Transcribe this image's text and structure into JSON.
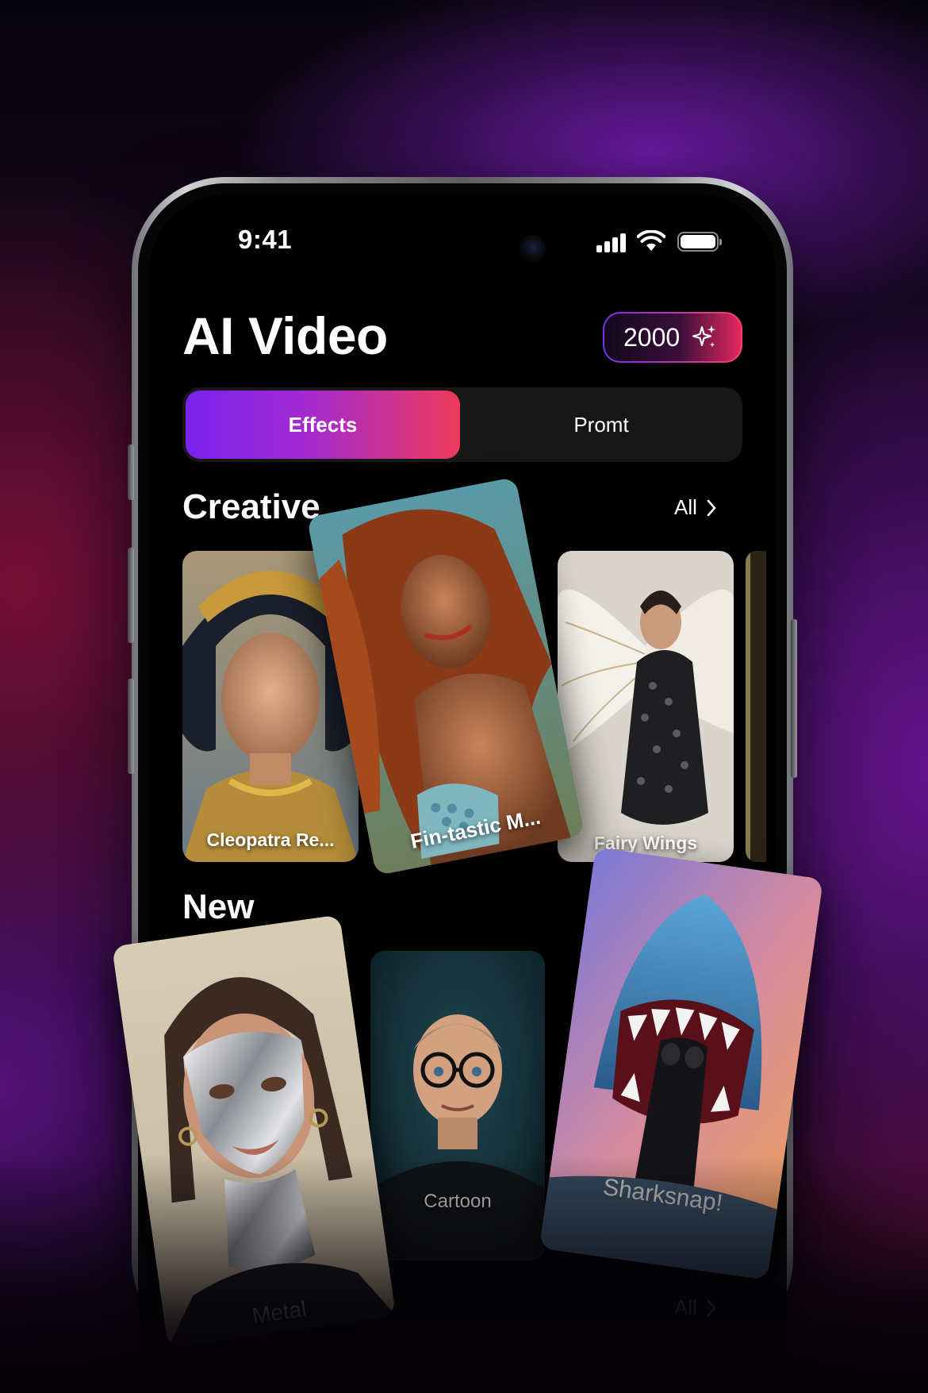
{
  "status_bar": {
    "time": "9:41"
  },
  "header": {
    "title": "AI Video",
    "credits": "2000",
    "credits_icon": "sparkle-icon"
  },
  "tabs": [
    {
      "label": "Effects",
      "active": true
    },
    {
      "label": "Promt",
      "active": false
    }
  ],
  "sections": {
    "creative": {
      "title": "Creative",
      "see_all": "All",
      "cards": [
        {
          "label": "Cleopatra Re..."
        },
        {
          "label": "Fin-tastic M..."
        },
        {
          "label": "Fairy Wings"
        }
      ]
    },
    "new": {
      "title": "New",
      "see_all": "All",
      "cards": [
        {
          "label": "Metal"
        },
        {
          "label": "Cartoon"
        },
        {
          "label": "Sharksnap!"
        }
      ]
    }
  },
  "colors": {
    "accent_start": "#7a22ee",
    "accent_end": "#ee3a5a",
    "background": "#000000"
  }
}
